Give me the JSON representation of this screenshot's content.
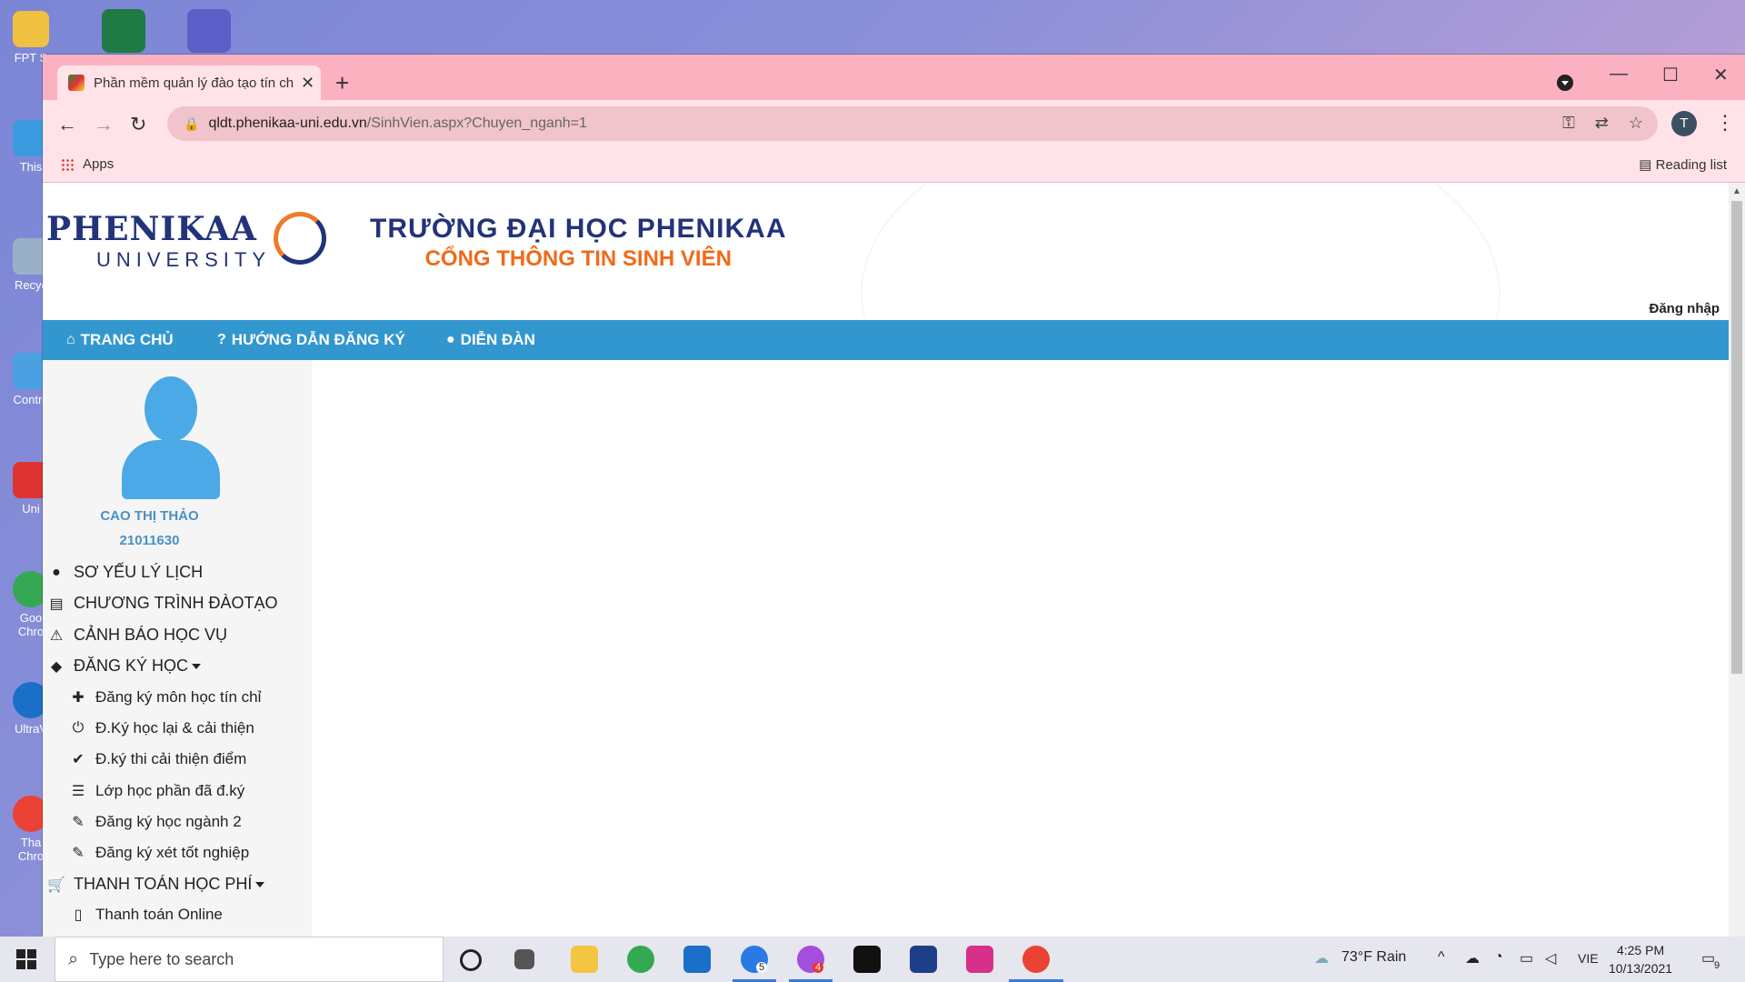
{
  "desktop": {
    "icons": [
      {
        "label": "FPT S",
        "color": "#f0c040"
      },
      {
        "label": "This",
        "color": "#3b9be0"
      },
      {
        "label": "Recyc",
        "color": "#9ab0c8"
      },
      {
        "label": "Contro",
        "color": "#4aa0e0"
      },
      {
        "label": "Uni",
        "color": "#d33"
      },
      {
        "label": "Goo Chro",
        "color": "#34a853"
      },
      {
        "label": "UltraV",
        "color": "#1a6fc9"
      },
      {
        "label": "Tha Chro",
        "color": "#ea4335"
      }
    ]
  },
  "browser": {
    "tab_title": "Phần mềm quản lý đào tạo tín chỉ",
    "tab_close": "✕",
    "new_tab": "+",
    "minimize": "—",
    "maximize": "☐",
    "close": "✕",
    "url_host": "qldt.phenikaa-uni.edu.vn",
    "url_path": "/SinhVien.aspx?Chuyen_nganh=1",
    "profile_initial": "T",
    "bookmark_apps": "Apps",
    "reading_list": "Reading list"
  },
  "page": {
    "logo_word": "PHENIKAA",
    "logo_sub": "UNIVERSITY",
    "school_line1": "TRƯỜNG ĐẠI HỌC PHENIKAA",
    "school_line2": "CỔNG THÔNG TIN SINH VIÊN",
    "login_link": "Đăng nhập",
    "nav": {
      "home": "TRANG CHỦ",
      "guide": "HƯỚNG DẪN ĐĂNG KÝ",
      "forum": "DIỄN ĐÀN"
    },
    "student": {
      "name": "CAO THỊ THẢO",
      "id": "21011630"
    },
    "menu": {
      "profile": "SƠ YẾU LÝ LỊCH",
      "program": "CHƯƠNG TRÌNH ĐÀOTẠO",
      "warning": "CẢNH BÁO HỌC VỤ",
      "register": "ĐĂNG KÝ HỌC",
      "sub_register_credit": "Đăng ký môn học tín chỉ",
      "sub_relearn": "Đ.Ký học lại & cải thiện",
      "sub_exam_improve": "Đ.ký thi cải thiện điểm",
      "sub_registered_classes": "Lớp học phần đã đ.ký",
      "sub_second_major": "Đăng ký học ngành 2",
      "sub_graduation": "Đăng ký xét tốt nghiệp",
      "tuition": "THANH TOÁN HỌC PHÍ",
      "sub_pay_online": "Thanh toán Online"
    },
    "colors": {
      "navbar": "#3397cf",
      "brand_blue": "#23337a",
      "brand_orange": "#f06a1a"
    }
  },
  "taskbar": {
    "search_placeholder": "Type here to search",
    "weather": "73°F  Rain",
    "language": "VIE",
    "time": "4:25 PM",
    "date": "10/13/2021",
    "notification_count": "9",
    "badge_1": "5",
    "badge_2": "4"
  }
}
